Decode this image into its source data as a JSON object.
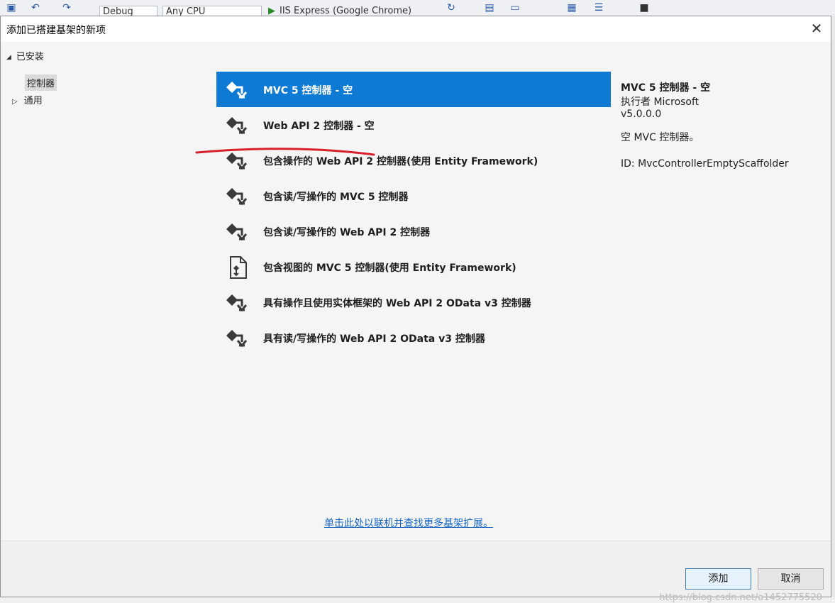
{
  "dialog": {
    "title": "添加已搭建基架的新项",
    "close_icon": "close-icon"
  },
  "tree": {
    "installed": "已安装",
    "controller": "控制器",
    "general": "通用"
  },
  "items": [
    {
      "label": "MVC 5 控制器 - 空",
      "icon": "controller-icon",
      "selected": true
    },
    {
      "label": "Web API 2 控制器 - 空",
      "icon": "controller-icon"
    },
    {
      "label": "包含操作的 Web API 2 控制器(使用 Entity Framework)",
      "icon": "controller-icon"
    },
    {
      "label": "包含读/写操作的 MVC 5 控制器",
      "icon": "controller-icon"
    },
    {
      "label": "包含读/写操作的 Web API 2 控制器",
      "icon": "controller-icon"
    },
    {
      "label": "包含视图的 MVC 5 控制器(使用 Entity Framework)",
      "icon": "document-controller-icon"
    },
    {
      "label": "具有操作且使用实体框架的 Web API 2 OData v3 控制器",
      "icon": "controller-icon"
    },
    {
      "label": "具有读/写操作的 Web API 2 OData v3 控制器",
      "icon": "controller-icon"
    }
  ],
  "description": {
    "name": "MVC 5 控制器 - 空",
    "author": "执行者 Microsoft",
    "version": "v5.0.0.0",
    "summary": "空 MVC 控制器。",
    "id": "ID: MvcControllerEmptyScaffolder"
  },
  "online_link": "单击此处以联机并查找更多基架扩展。",
  "buttons": {
    "add": "添加",
    "cancel": "取消"
  },
  "watermark": "https://blog.csdn.net/a1452775520",
  "ide": {
    "config": "Debug",
    "platform": "Any CPU",
    "run_target": "IIS Express (Google Chrome)"
  },
  "colors": {
    "selection": "#0e7ad3",
    "link": "#1565c0",
    "annotation": "#d9202a"
  }
}
